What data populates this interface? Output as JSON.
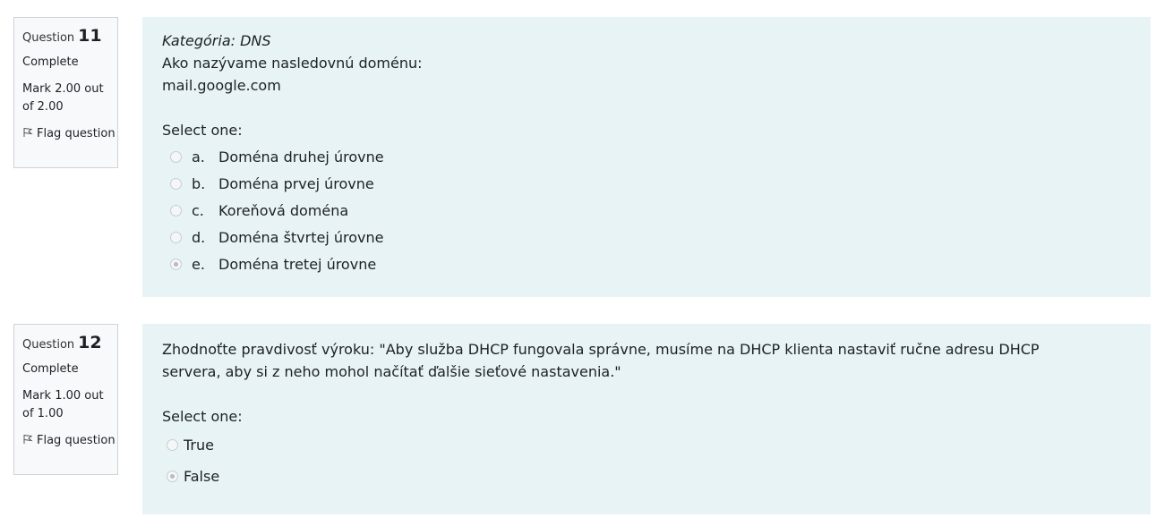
{
  "q11": {
    "label": "Question",
    "number": "11",
    "state": "Complete",
    "grade": "Mark 2.00 out of 2.00",
    "flag": "Flag question",
    "category": "Kategória: DNS",
    "text_line1": "Ako nazývame nasledovnú doménu:",
    "text_line2": "mail.google.com",
    "prompt": "Select one:",
    "options": [
      {
        "letter": "a.",
        "text": "Doména druhej úrovne",
        "checked": false
      },
      {
        "letter": "b.",
        "text": "Doména prvej úrovne",
        "checked": false
      },
      {
        "letter": "c.",
        "text": "Koreňová doména",
        "checked": false
      },
      {
        "letter": "d.",
        "text": "Doména štvrtej úrovne",
        "checked": false
      },
      {
        "letter": "e.",
        "text": "Doména tretej úrovne",
        "checked": true
      }
    ]
  },
  "q12": {
    "label": "Question",
    "number": "12",
    "state": "Complete",
    "grade": "Mark 1.00 out of 1.00",
    "flag": "Flag question",
    "text": "Zhodnoťte pravdivosť výroku: \"Aby služba DHCP fungovala správne, musíme na DHCP klienta nastaviť ručne adresu DHCP servera, aby si z neho mohol načítať ďalšie sieťové nastavenia.\"",
    "prompt": "Select one:",
    "options": [
      {
        "text": "True",
        "checked": false
      },
      {
        "text": "False",
        "checked": true
      }
    ]
  }
}
